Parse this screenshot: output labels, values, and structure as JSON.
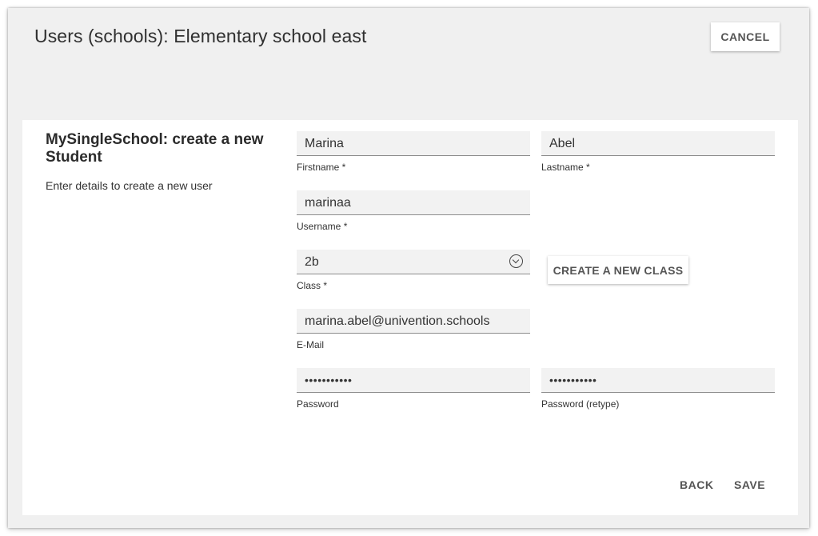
{
  "header": {
    "title": "Users (schools): Elementary school east",
    "cancel_label": "CANCEL"
  },
  "sidebar": {
    "title": "MySingleSchool: create a new Student",
    "description": "Enter details to create a new user"
  },
  "form": {
    "firstname": {
      "value": "Marina",
      "label": "Firstname *"
    },
    "lastname": {
      "value": "Abel",
      "label": "Lastname *"
    },
    "username": {
      "value": "marinaa",
      "label": "Username *"
    },
    "class": {
      "value": "2b",
      "label": "Class *"
    },
    "create_class_label": "CREATE A NEW CLASS",
    "email": {
      "value": "marina.abel@univention.schools",
      "label": "E-Mail"
    },
    "password": {
      "value": "•••••••••••",
      "label": "Password"
    },
    "password_retype": {
      "value": "•••••••••••",
      "label": "Password (retype)"
    }
  },
  "footer": {
    "back_label": "BACK",
    "save_label": "SAVE"
  },
  "icons": {
    "class_dropdown": "chevron-down-circle-icon"
  }
}
